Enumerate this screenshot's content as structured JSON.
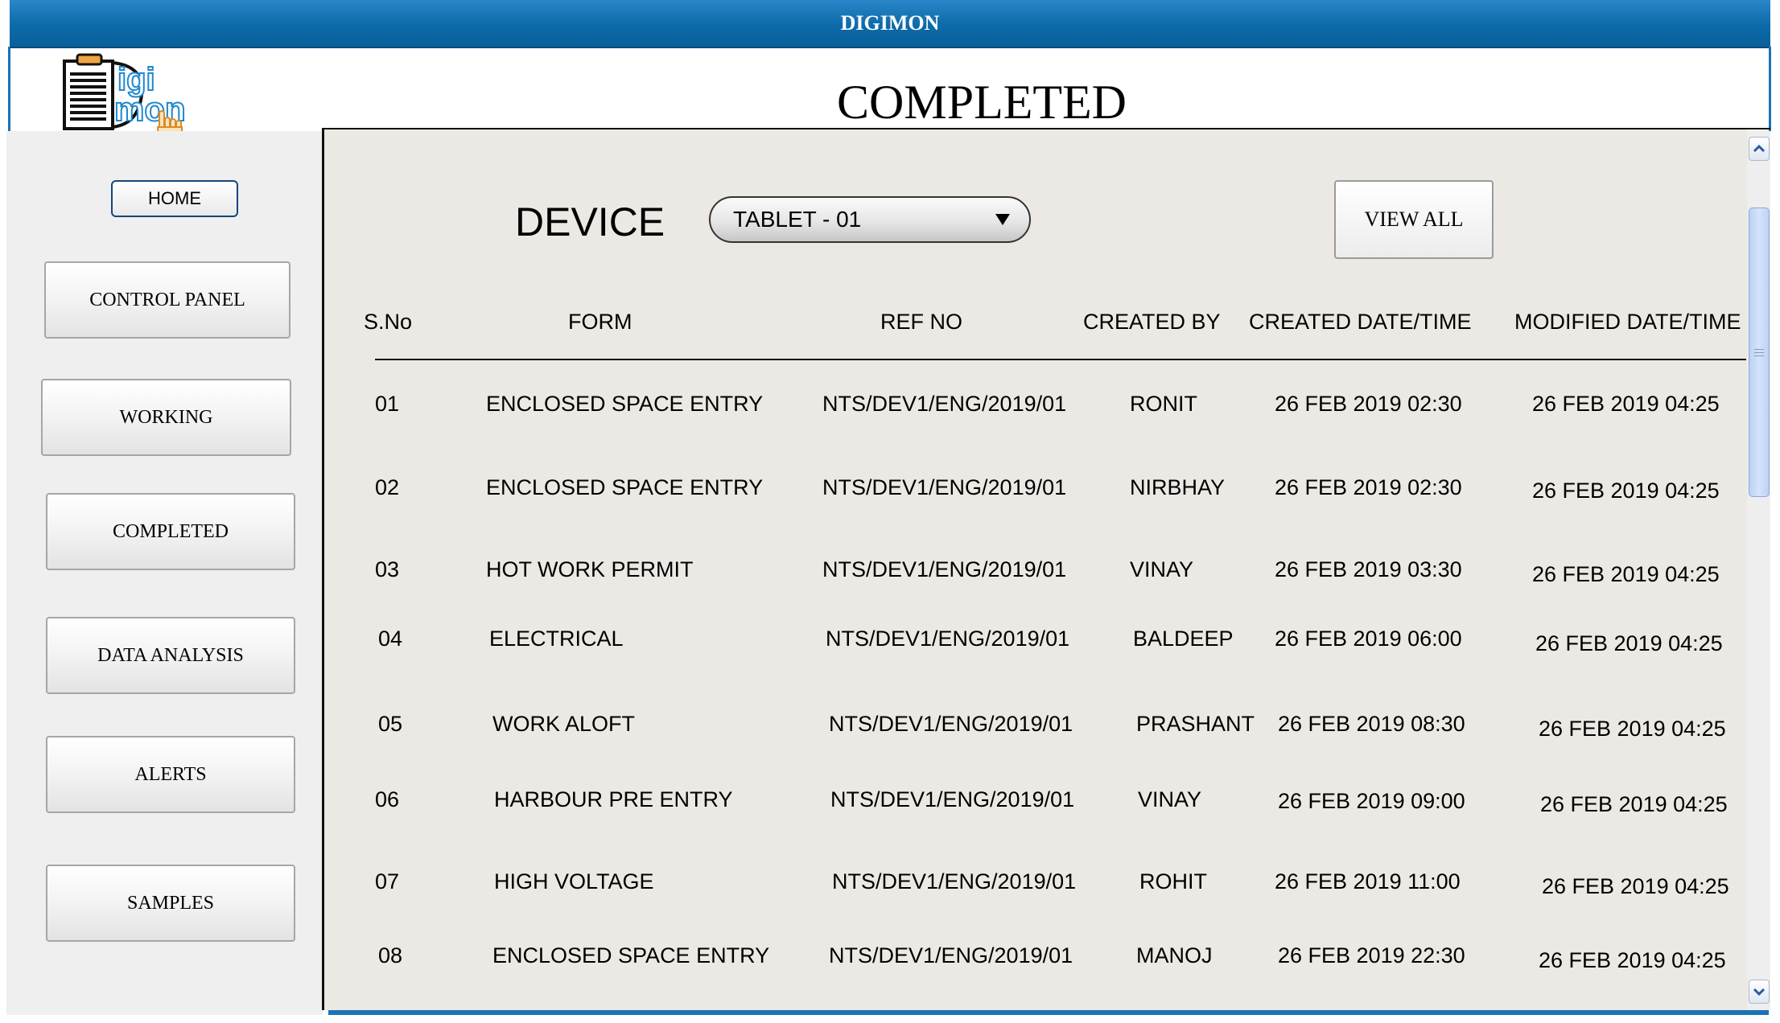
{
  "app": {
    "title": "DIGIMON"
  },
  "logo": {
    "text_top": "igi",
    "text_bottom": "mon"
  },
  "page": {
    "title": "COMPLETED"
  },
  "sidebar": {
    "home": "HOME",
    "items": [
      "CONTROL PANEL",
      "WORKING",
      "COMPLETED",
      "DATA ANALYSIS",
      "ALERTS",
      "SAMPLES"
    ]
  },
  "filter": {
    "device_label": "DEVICE",
    "device_value": "TABLET - 01",
    "view_all": "VIEW ALL"
  },
  "table": {
    "headers": [
      "S.No",
      "FORM",
      "REF NO",
      "CREATED BY",
      "CREATED DATE/TIME",
      "MODIFIED DATE/TIME"
    ],
    "rows": [
      [
        "01",
        "ENCLOSED SPACE ENTRY",
        "NTS/DEV1/ENG/2019/01",
        "RONIT",
        "26 FEB 2019 02:30",
        "26 FEB 2019 04:25"
      ],
      [
        "02",
        "ENCLOSED SPACE ENTRY",
        "NTS/DEV1/ENG/2019/01",
        "NIRBHAY",
        "26 FEB 2019 02:30",
        "26 FEB 2019 04:25"
      ],
      [
        "03",
        "HOT WORK PERMIT",
        "NTS/DEV1/ENG/2019/01",
        "VINAY",
        "26 FEB 2019 03:30",
        "26 FEB 2019 04:25"
      ],
      [
        "04",
        "ELECTRICAL",
        "NTS/DEV1/ENG/2019/01",
        "BALDEEP",
        "26 FEB 2019 06:00",
        "26 FEB 2019 04:25"
      ],
      [
        "05",
        "WORK ALOFT",
        "NTS/DEV1/ENG/2019/01",
        "PRASHANT",
        "26 FEB 2019 08:30",
        "26 FEB 2019 04:25"
      ],
      [
        "06",
        "HARBOUR PRE ENTRY",
        "NTS/DEV1/ENG/2019/01",
        "VINAY",
        "26 FEB 2019 09:00",
        "26 FEB 2019 04:25"
      ],
      [
        "07",
        "HIGH VOLTAGE",
        "NTS/DEV1/ENG/2019/01",
        "ROHIT",
        "26 FEB 2019 11:00",
        "26 FEB 2019 04:25"
      ],
      [
        "08",
        "ENCLOSED SPACE ENTRY",
        "NTS/DEV1/ENG/2019/01",
        "MANOJ",
        "26 FEB 2019 22:30",
        "26 FEB 2019 04:25"
      ]
    ]
  },
  "colors": {
    "title_bar": "#0d6aa9",
    "panel_bg": "#ece9e4",
    "sidebar_bg": "#efefef",
    "logo_blue": "#1e88d0"
  },
  "icons": {
    "scroll_up": "chevron-up-icon",
    "scroll_down": "chevron-down-icon",
    "dropdown": "caret-down-icon"
  }
}
